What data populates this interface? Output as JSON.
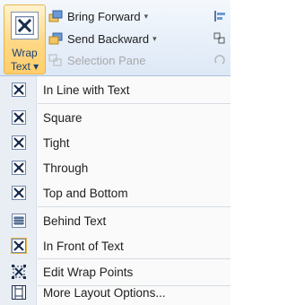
{
  "ribbon": {
    "wrap_text": {
      "line1": "Wrap",
      "line2": "Text ▾",
      "icon": "wrap-text-icon"
    },
    "bring_forward": {
      "label": "Bring Forward",
      "icon": "bring-forward-icon"
    },
    "send_backward": {
      "label": "Send Backward",
      "icon": "send-backward-icon"
    },
    "selection_pane": {
      "label": "Selection Pane",
      "icon": "selection-pane-icon"
    },
    "dropdown_arrow": "▾"
  },
  "menu": {
    "items": [
      {
        "label": "In Line with Text",
        "icon": "in-line-with-text-icon"
      },
      {
        "label": "Square",
        "icon": "square-wrap-icon"
      },
      {
        "label": "Tight",
        "icon": "tight-wrap-icon"
      },
      {
        "label": "Through",
        "icon": "through-wrap-icon"
      },
      {
        "label": "Top and Bottom",
        "icon": "top-and-bottom-wrap-icon"
      },
      {
        "label": "Behind Text",
        "icon": "behind-text-icon"
      },
      {
        "label": "In Front of Text",
        "icon": "in-front-of-text-icon"
      },
      {
        "label": "Edit Wrap Points",
        "icon": "edit-wrap-points-icon"
      },
      {
        "label": "More Layout Options...",
        "icon": "more-layout-options-icon"
      }
    ],
    "selected_index": 6
  },
  "colors": {
    "ribbon_bg": "#dde8f6",
    "highlight": "#ffd886",
    "gutter": "#e9eef4",
    "icon_blue": "#1c3f72"
  }
}
